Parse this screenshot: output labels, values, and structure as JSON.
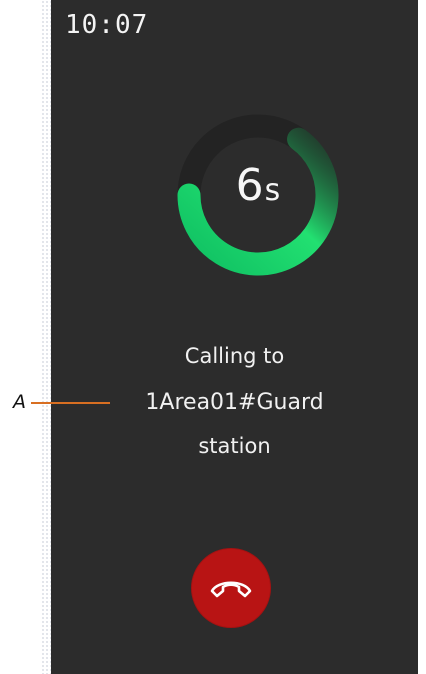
{
  "status_bar": {
    "time": "10:07"
  },
  "timer": {
    "value": "6",
    "unit": "s",
    "progress_fraction": 0.65
  },
  "call_status": {
    "line1": "Calling to",
    "line2": "1Area01#Guard",
    "line3": "station"
  },
  "controls": {
    "hangup_icon": "phone-hangup-icon"
  },
  "annotation": {
    "label": "A"
  },
  "colors": {
    "screen_background": "#2c2c2c",
    "ring_track": "#222222",
    "ring_accent": "#1fd86b",
    "hangup_red": "#b81414",
    "annotation_orange": "#d86f22"
  }
}
